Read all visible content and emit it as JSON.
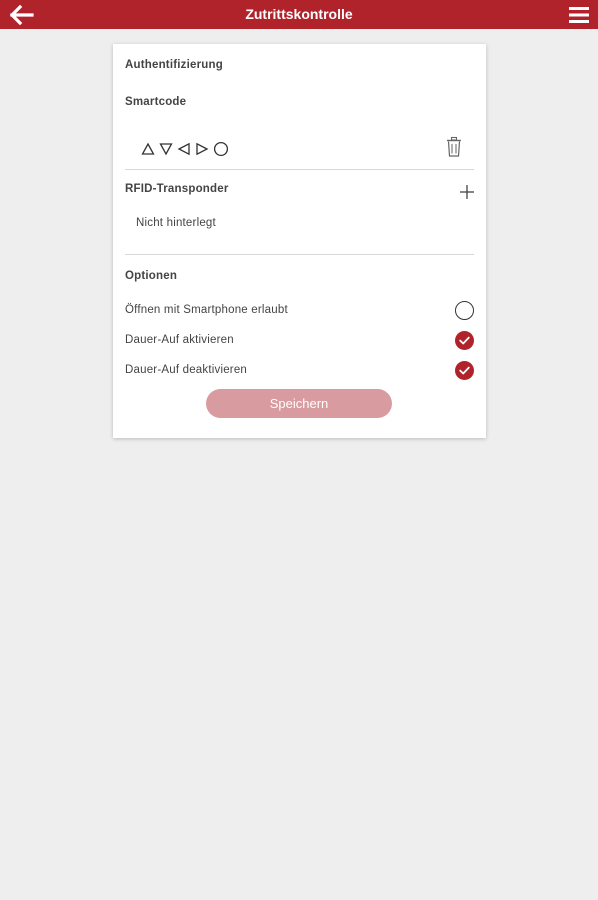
{
  "header": {
    "title": "Zutrittskontrolle",
    "back_icon": "arrow-left-icon",
    "menu_icon": "hamburger-menu-icon"
  },
  "authentication": {
    "heading": "Authentifizierung",
    "smartcode": {
      "heading": "Smartcode",
      "symbols": [
        "triangle-up",
        "triangle-down",
        "triangle-left",
        "triangle-right",
        "circle"
      ],
      "delete_icon": "trash-icon"
    },
    "rfid": {
      "heading": "RFID-Transponder",
      "add_icon": "plus-icon",
      "value": "Nicht hinterlegt"
    }
  },
  "options": {
    "heading": "Optionen",
    "items": [
      {
        "label": "Öffnen mit Smartphone erlaubt",
        "checked": false
      },
      {
        "label": "Dauer-Auf aktivieren",
        "checked": true
      },
      {
        "label": "Dauer-Auf deaktivieren",
        "checked": true
      }
    ]
  },
  "save_label": "Speichern",
  "colors": {
    "accent": "#b0232b",
    "button_disabled": "#d89ba0",
    "background": "#eeeeee"
  }
}
